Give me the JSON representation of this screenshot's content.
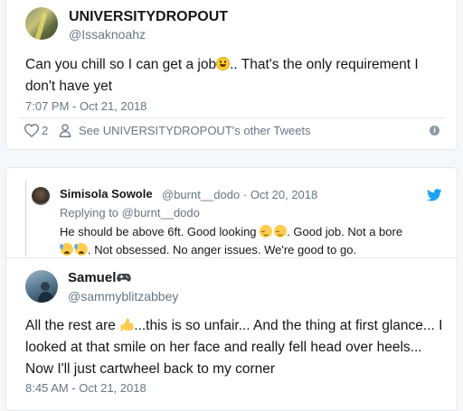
{
  "tweet": {
    "display_name": "UNIVERSITYDROPOUT",
    "handle": "@Issaknoahz",
    "text_part1": "Can you chill so I can get a job",
    "text_part2": ".. That's the only requirement I don't have yet",
    "timestamp": "7:07 PM - Oct 21, 2018",
    "like_count": "2",
    "see_other_label": "See UNIVERSITYDROPOUT's other Tweets",
    "icons": [
      "heart-icon",
      "person-icon",
      "info-icon"
    ],
    "emoji": "grinning-face"
  },
  "quoted": {
    "display_name": "Simisola Sowole",
    "handle": "@burnt__dodo",
    "separator": "·",
    "date": "Oct 20, 2018",
    "replying_to": "Replying to @burnt__dodo",
    "line1": "He should be above 6ft. Good looking ",
    "line1b": ". Good job. Not a bore",
    "line2": ". Not obsessed. No anger issues. We're good to go.",
    "emoji1": "relieved-face",
    "emoji2": "sad-sweat-face"
  },
  "reply": {
    "display_name": "Samuel",
    "handle": "@sammyblitzabbey",
    "text_part1": "All the rest are ",
    "text_part2": "...this is so unfair... And the thing at first glance... I looked at that smile on her face and really fell head over heels... Now I'll just cartwheel back to my corner",
    "timestamp": "8:45 AM - Oct 21, 2018",
    "name_icon": "game-controller-icon",
    "emoji": "thumbs-up"
  },
  "colors": {
    "text": "#14171a",
    "secondary": "#657786",
    "twitter_blue": "#1da1f2",
    "border": "#e1e8ed"
  }
}
